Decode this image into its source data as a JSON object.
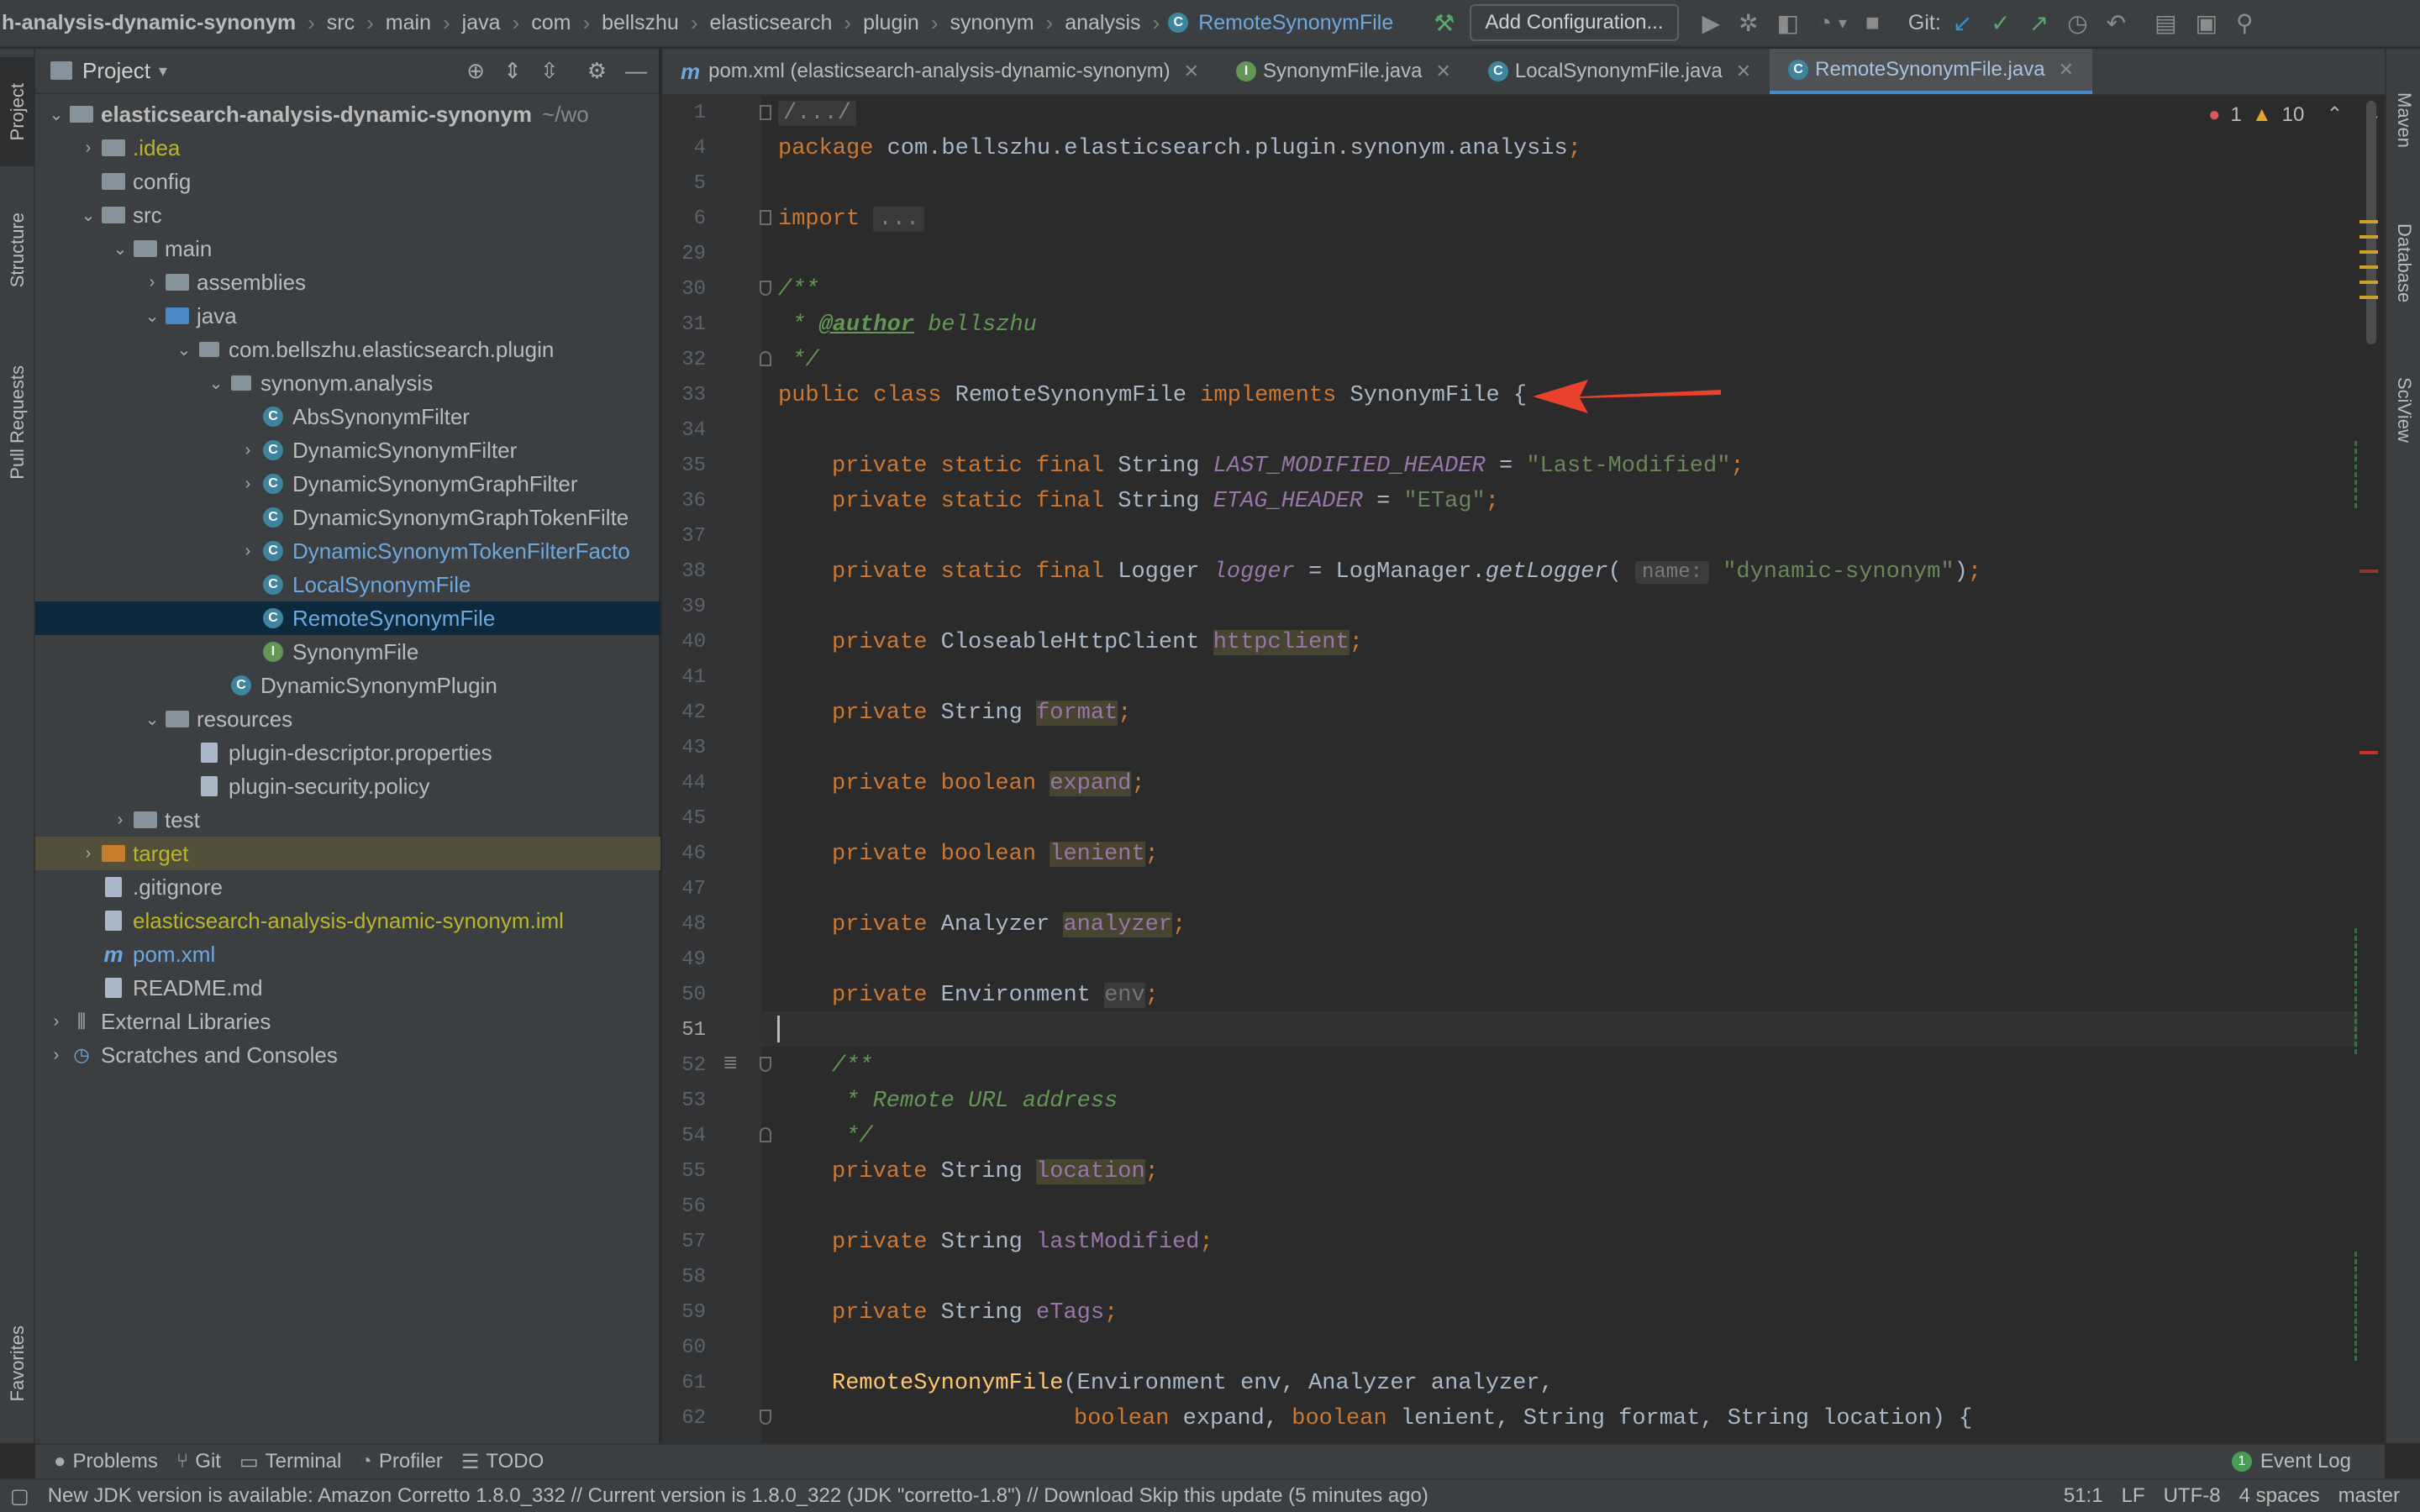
{
  "navbar": {
    "crumbs": [
      "h-analysis-dynamic-synonym",
      "src",
      "main",
      "java",
      "com",
      "bellszhu",
      "elasticsearch",
      "plugin",
      "synonym",
      "analysis"
    ],
    "current_file": "RemoteSynonymFile",
    "add_config": "Add Configuration...",
    "git_label": "Git:"
  },
  "left_tabs": {
    "project": "Project",
    "structure": "Structure",
    "pull_requests": "Pull Requests",
    "favorites": "Favorites"
  },
  "right_tabs": {
    "maven": "Maven",
    "database": "Database",
    "sciview": "SciView"
  },
  "project_panel": {
    "title": "Project",
    "items": [
      {
        "label": "elasticsearch-analysis-dynamic-synonym",
        "suffix": "~/wo",
        "depth": 0,
        "arrow": "down",
        "icon": "folder",
        "bold": true
      },
      {
        "label": ".idea",
        "depth": 1,
        "arrow": "right",
        "icon": "folder",
        "color": "yellow"
      },
      {
        "label": "config",
        "depth": 1,
        "arrow": "",
        "icon": "folder"
      },
      {
        "label": "src",
        "depth": 1,
        "arrow": "down",
        "icon": "folder"
      },
      {
        "label": "main",
        "depth": 2,
        "arrow": "down",
        "icon": "folder"
      },
      {
        "label": "assemblies",
        "depth": 3,
        "arrow": "right",
        "icon": "folder"
      },
      {
        "label": "java",
        "depth": 3,
        "arrow": "down",
        "icon": "folder-blue"
      },
      {
        "label": "com.bellszhu.elasticsearch.plugin",
        "depth": 4,
        "arrow": "down",
        "icon": "package"
      },
      {
        "label": "synonym.analysis",
        "depth": 5,
        "arrow": "down",
        "icon": "package"
      },
      {
        "label": "AbsSynonymFilter",
        "depth": 6,
        "arrow": "",
        "icon": "class"
      },
      {
        "label": "DynamicSynonymFilter",
        "depth": 6,
        "arrow": "right",
        "icon": "class"
      },
      {
        "label": "DynamicSynonymGraphFilter",
        "depth": 6,
        "arrow": "right",
        "icon": "class"
      },
      {
        "label": "DynamicSynonymGraphTokenFilte",
        "depth": 6,
        "arrow": "",
        "icon": "class"
      },
      {
        "label": "DynamicSynonymTokenFilterFacto",
        "depth": 6,
        "arrow": "right",
        "icon": "class",
        "color": "blue"
      },
      {
        "label": "LocalSynonymFile",
        "depth": 6,
        "arrow": "",
        "icon": "class",
        "color": "blue"
      },
      {
        "label": "RemoteSynonymFile",
        "depth": 6,
        "arrow": "",
        "icon": "class",
        "color": "blue",
        "selected": true
      },
      {
        "label": "SynonymFile",
        "depth": 6,
        "arrow": "",
        "icon": "interface"
      },
      {
        "label": "DynamicSynonymPlugin",
        "depth": 5,
        "arrow": "",
        "icon": "class"
      },
      {
        "label": "resources",
        "depth": 3,
        "arrow": "down",
        "icon": "folder"
      },
      {
        "label": "plugin-descriptor.properties",
        "depth": 4,
        "arrow": "",
        "icon": "file"
      },
      {
        "label": "plugin-security.policy",
        "depth": 4,
        "arrow": "",
        "icon": "file"
      },
      {
        "label": "test",
        "depth": 2,
        "arrow": "right",
        "icon": "folder"
      },
      {
        "label": "target",
        "depth": 1,
        "arrow": "right",
        "icon": "folder-orange",
        "color": "yellow",
        "highlight": true
      },
      {
        "label": ".gitignore",
        "depth": 1,
        "arrow": "",
        "icon": "file"
      },
      {
        "label": "elasticsearch-analysis-dynamic-synonym.iml",
        "depth": 1,
        "arrow": "",
        "icon": "file",
        "color": "yellow"
      },
      {
        "label": "pom.xml",
        "depth": 1,
        "arrow": "",
        "icon": "maven",
        "color": "blue"
      },
      {
        "label": "README.md",
        "depth": 1,
        "arrow": "",
        "icon": "file"
      },
      {
        "label": "External Libraries",
        "depth": 0,
        "arrow": "right",
        "icon": "library"
      },
      {
        "label": "Scratches and Consoles",
        "depth": 0,
        "arrow": "right",
        "icon": "scratch"
      }
    ]
  },
  "tabs": [
    {
      "label": "pom.xml (elasticsearch-analysis-dynamic-synonym)",
      "icon": "m",
      "active": false
    },
    {
      "label": "SynonymFile.java",
      "icon": "interface",
      "active": false
    },
    {
      "label": "LocalSynonymFile.java",
      "icon": "class",
      "active": false
    },
    {
      "label": "RemoteSynonymFile.java",
      "icon": "class",
      "active": true
    }
  ],
  "inspection": {
    "errors": "1",
    "warnings": "10"
  },
  "line_numbers": [
    "1",
    "4",
    "5",
    "6",
    "29",
    "30",
    "31",
    "32",
    "33",
    "34",
    "35",
    "36",
    "37",
    "38",
    "39",
    "40",
    "41",
    "42",
    "43",
    "44",
    "45",
    "46",
    "47",
    "48",
    "49",
    "50",
    "51",
    "52",
    "53",
    "54",
    "55",
    "56",
    "57",
    "58",
    "59",
    "60",
    "61",
    "62"
  ],
  "code": {
    "l1": "/.../",
    "l4_pkg": "package",
    "l4_name": " com.bellszhu.elasticsearch.plugin.synonym.analysis",
    "l6_import": "import",
    "l6_fold": "...",
    "l30": "/**",
    "l31_star": " * ",
    "l31_tag": "@author",
    "l31_name": " bellszhu",
    "l32": " */",
    "l33_mods": "public class",
    "l33_name": " RemoteSynonymFile ",
    "l33_impl": "implements",
    "l33_rest": " SynonymFile {",
    "kw_psf": "private static final",
    "kw_private": "private",
    "kw_boolean": "boolean",
    "t_string": " String ",
    "f_last_mod_header": "LAST_MODIFIED_HEADER",
    "f_etag_header": "ETAG_HEADER",
    "eq": " = ",
    "s_last_modified": "\"Last-Modified\"",
    "s_etag": "\"ETag\"",
    "t_logger": " Logger ",
    "f_logger": "logger",
    "logmgr": " = LogManager.",
    "getlogger": "getLogger",
    "hint_name": "name:",
    "s_dynsyn": "\"dynamic-synonym\"",
    "t_client": " CloseableHttpClient ",
    "f_httpclient": "httpclient",
    "f_format": "format",
    "f_expand": "expand",
    "f_lenient": "lenient",
    "t_analyzer": " Analyzer ",
    "f_analyzer": "analyzer",
    "t_env": " Environment ",
    "f_env": "env",
    "l52": "/**",
    "l53": " * Remote URL address",
    "l54": " */",
    "f_location": "location",
    "f_lastmodified": "lastModified",
    "f_etags": "eTags",
    "ctor": "RemoteSynonymFile",
    "ctor_args": "(Environment env, Analyzer analyzer,",
    "l62_a": "boolean",
    "l62_b": " expand, ",
    "l62_c": "boolean",
    "l62_d": " lenient, String format, String location) {",
    "semi": ";"
  },
  "tool_windows": [
    "Problems",
    "Git",
    "Terminal",
    "Profiler",
    "TODO"
  ],
  "event_log": {
    "count": "1",
    "label": "Event Log"
  },
  "status": {
    "message": "New JDK version is available: Amazon Corretto 1.8.0_332 // Current version is 1.8.0_322 (JDK \"corretto-1.8\") // Download    Skip this update (5 minutes ago)",
    "position": "51:1",
    "line_sep": "LF",
    "encoding": "UTF-8",
    "indent": "4 spaces",
    "branch": "master"
  },
  "colors": {
    "accent": "#4a88c7",
    "arrow": "#e8412c",
    "selection": "#0d293e"
  }
}
